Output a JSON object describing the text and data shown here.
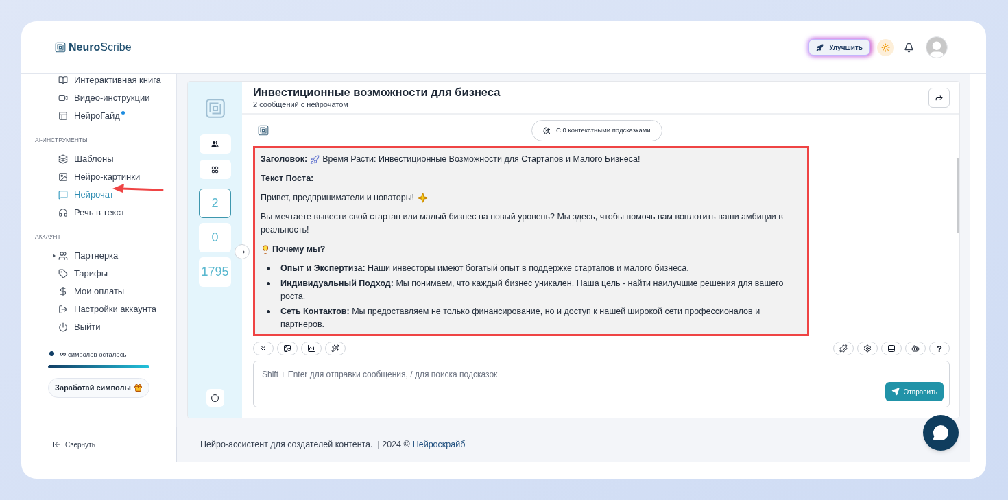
{
  "header": {
    "logo_bold": "Neuro",
    "logo_light": "Scribe",
    "upgrade_button": "Улучшить"
  },
  "sidebar": {
    "sections": [
      {
        "items": [
          {
            "label": "Интерактивная книга",
            "selected": false,
            "dot": false,
            "expandable": false
          },
          {
            "label": "Видео-инструкции",
            "selected": false,
            "dot": false,
            "expandable": false
          },
          {
            "label": "НейроГайд",
            "selected": false,
            "dot": true,
            "expandable": false
          }
        ]
      },
      {
        "title": "AI-ИНСТРУМЕНТЫ",
        "items": [
          {
            "label": "Шаблоны",
            "selected": false,
            "dot": false,
            "expandable": false
          },
          {
            "label": "Нейро-картинки",
            "selected": false,
            "dot": false,
            "expandable": false
          },
          {
            "label": "Нейрочат",
            "selected": true,
            "dot": false,
            "expandable": false
          },
          {
            "label": "Речь в текст",
            "selected": false,
            "dot": false,
            "expandable": false
          }
        ]
      },
      {
        "title": "АККАУНТ",
        "items": [
          {
            "label": "Партнерка",
            "selected": false,
            "dot": false,
            "expandable": true
          },
          {
            "label": "Тарифы",
            "selected": false,
            "dot": false,
            "expandable": false
          },
          {
            "label": "Мои оплаты",
            "selected": false,
            "dot": false,
            "expandable": false
          },
          {
            "label": "Настройки аккаунта",
            "selected": false,
            "dot": false,
            "expandable": false
          },
          {
            "label": "Выйти",
            "selected": false,
            "dot": false,
            "expandable": false
          }
        ]
      }
    ],
    "symbols": {
      "infinity": "∞",
      "label": "символов осталось",
      "level": 1
    },
    "earn_button": "Заработай символы",
    "collapse": "Свернуть"
  },
  "chat": {
    "title": "Инвестиционные возможности для бизнеса",
    "subtitle": "2 сообщений с нейрочатом",
    "counters": [
      {
        "value": "2",
        "selected": true
      },
      {
        "value": "0",
        "selected": false
      },
      {
        "value": "1795",
        "selected": false
      }
    ],
    "context_chip": "С 0 контекстными подсказками",
    "message": [
      {
        "kind": "title_line",
        "text": "**Заголовок:** Время Расти: Инвестиционные Возможности для Стартапов и Малого Бизнеса!"
      },
      {
        "kind": "paragraph",
        "text": "**Текст Поста:**"
      },
      {
        "kind": "greeting",
        "text": "Привет, предприниматели и новаторы!"
      },
      {
        "kind": "paragraph",
        "text": "Вы мечтаете вывести свой стартап или малый бизнес на новый уровень? Мы здесь, чтобы помочь вам воплотить ваши амбиции в реальность!"
      },
      {
        "kind": "section_heading",
        "text": "Почему мы?"
      },
      {
        "kind": "bullets",
        "items": [
          "**Опыт и Экспертиза:** Наши инвесторы имеют богатый опыт в поддержке стартапов и малого бизнеса.",
          "**Индивидуальный Подход:** Мы понимаем, что каждый бизнес уникален. Наша цель - найти наилучшие решения для вашего роста.",
          "**Сеть Контактов:** Мы предоставляем не только финансирование, но и доступ к нашей широкой сети профессионалов и партнеров."
        ]
      }
    ],
    "help_button": "?",
    "input": {
      "placeholder": "Shift + Enter для отправки сообщения, / для поиска подсказок"
    },
    "send_button": "Отправить"
  },
  "footer": {
    "text": "Нейро-ассистент для создателей контента.  | 2024 ©",
    "link": "Нейроскрайб"
  }
}
